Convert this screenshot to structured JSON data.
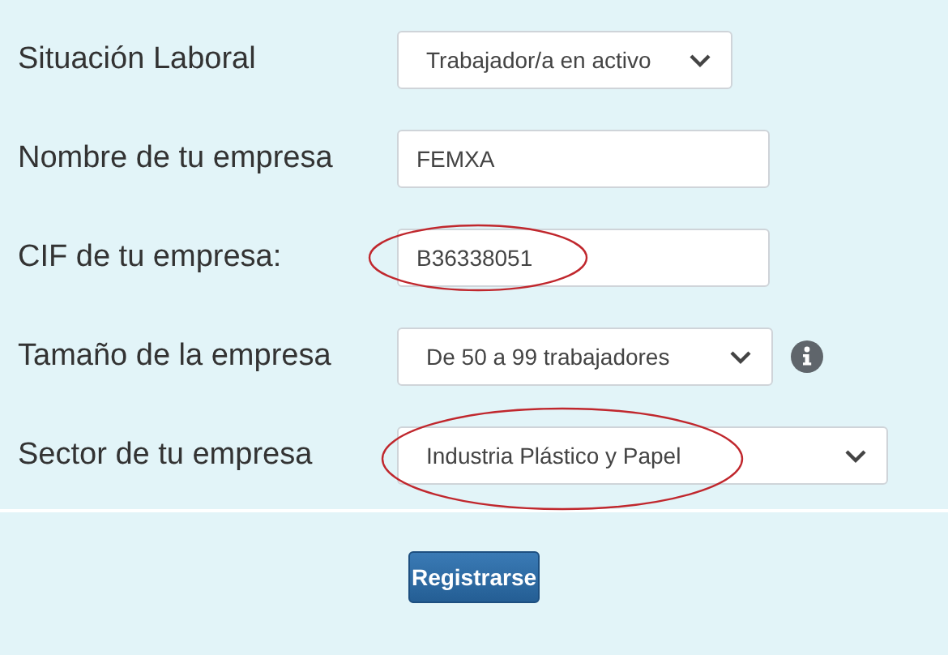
{
  "form": {
    "fields": [
      {
        "label": "Situación Laboral",
        "kind": "select",
        "value": "Trabajador/a en activo",
        "circled": false,
        "info": false
      },
      {
        "label": "Nombre de tu empresa",
        "kind": "input",
        "value": "FEMXA",
        "circled": false,
        "info": false
      },
      {
        "label": "CIF de tu empresa:",
        "kind": "input",
        "value": "B36338051",
        "circled": true,
        "info": false
      },
      {
        "label": "Tamaño de la empresa",
        "kind": "select",
        "value": "De 50 a 99 trabajadores",
        "circled": false,
        "info": true
      },
      {
        "label": "Sector de tu empresa",
        "kind": "select",
        "value": "Industria Plástico y Papel",
        "circled": true,
        "info": false
      }
    ],
    "submit": "Registrarse"
  }
}
